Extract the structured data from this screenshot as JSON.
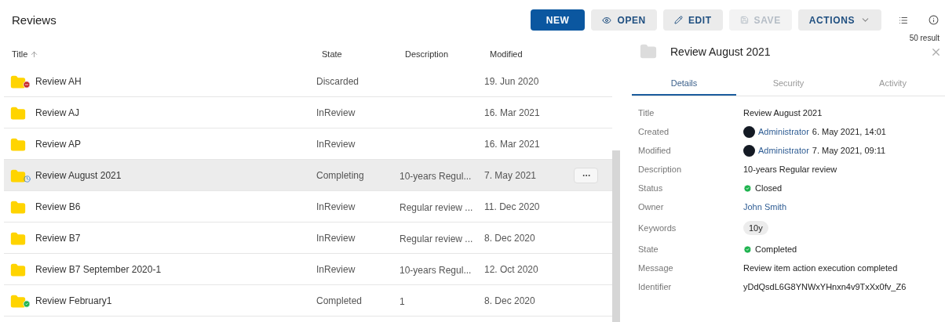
{
  "page": {
    "title": "Reviews"
  },
  "toolbar": {
    "buttons": [
      {
        "label": "NEW",
        "kind": "primary",
        "disabled": false
      },
      {
        "label": "OPEN",
        "kind": "eye",
        "disabled": false
      },
      {
        "label": "EDIT",
        "kind": "pencil",
        "disabled": false
      },
      {
        "label": "SAVE",
        "kind": "save",
        "disabled": true
      },
      {
        "label": "ACTIONS",
        "kind": "menu",
        "disabled": false
      }
    ],
    "results": "50 result"
  },
  "table": {
    "columns": [
      {
        "label": "Title",
        "sorted": true
      },
      {
        "label": "State",
        "sorted": false
      },
      {
        "label": "Description",
        "sorted": false
      },
      {
        "label": "Modified",
        "sorted": false
      }
    ],
    "rows": [
      {
        "title": "Review AH",
        "kind": "discarded",
        "state": "Discarded",
        "description": "",
        "modified": "19. Jun 2020",
        "selected": false
      },
      {
        "title": "Review AJ",
        "kind": "plain",
        "state": "InReview",
        "description": "",
        "modified": "16. Mar 2021",
        "selected": false
      },
      {
        "title": "Review AP",
        "kind": "plain",
        "state": "InReview",
        "description": "",
        "modified": "16. Mar 2021",
        "selected": false
      },
      {
        "title": "Review August 2021",
        "kind": "completing",
        "state": "Completing",
        "description": "10-years Regul...",
        "modified": "7. May 2021",
        "selected": true
      },
      {
        "title": "Review B6",
        "kind": "plain",
        "state": "InReview",
        "description": "Regular review ...",
        "modified": "11. Dec 2020",
        "selected": false
      },
      {
        "title": "Review B7",
        "kind": "plain",
        "state": "InReview",
        "description": "Regular review ...",
        "modified": "8. Dec 2020",
        "selected": false
      },
      {
        "title": "Review B7 September 2020-1",
        "kind": "plain",
        "state": "InReview",
        "description": "10-years Regul...",
        "modified": "12. Oct 2020",
        "selected": false
      },
      {
        "title": "Review February1",
        "kind": "completed",
        "state": "Completed",
        "description": "1",
        "modified": "8. Dec 2020",
        "selected": false
      }
    ]
  },
  "details": {
    "title": "Review August 2021",
    "tabs": [
      {
        "label": "Details",
        "selected": true
      },
      {
        "label": "Security",
        "selected": false
      },
      {
        "label": "Activity",
        "selected": false
      }
    ],
    "fields": [
      {
        "label": "Title",
        "kind": "text",
        "value": "Review August 2021"
      },
      {
        "label": "Created",
        "kind": "user",
        "user": "Administrator",
        "value": "6. May 2021, 14:01"
      },
      {
        "label": "Modified",
        "kind": "user",
        "user": "Administrator",
        "value": "7. May 2021, 09:11"
      },
      {
        "label": "Description",
        "kind": "text",
        "value": "10-years Regular review"
      },
      {
        "label": "Status",
        "kind": "status",
        "value": "Closed"
      },
      {
        "label": "Owner",
        "kind": "link",
        "value": "John Smith"
      },
      {
        "label": "Keywords",
        "kind": "chip",
        "value": "10y"
      },
      {
        "label": "State",
        "kind": "status",
        "value": "Completed"
      },
      {
        "label": "Message",
        "kind": "text",
        "value": "Review item action execution completed"
      },
      {
        "label": "Identifier",
        "kind": "text",
        "value": "yDdQsdL6G8YNWxYHnxn4v9TxXx0fv_Z6"
      }
    ]
  }
}
